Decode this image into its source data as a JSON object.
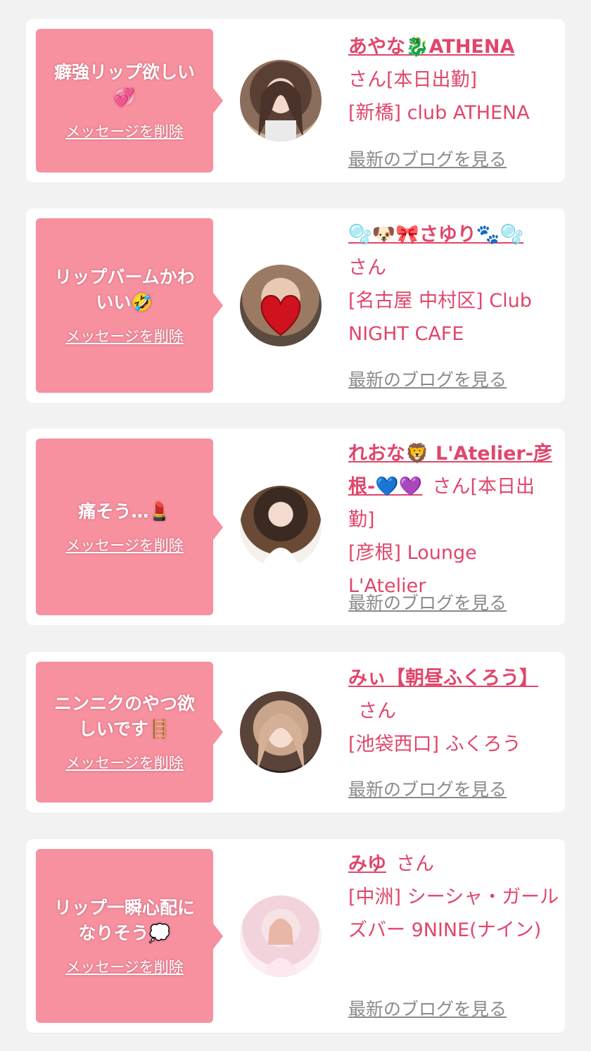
{
  "common": {
    "delete_label": "メッセージを削除",
    "blog_label": "最新のブログを見る",
    "honorific": "さん"
  },
  "colors": {
    "page_bg": "#f2f2f2",
    "card_bg": "#ffffff",
    "bubble_bg": "#f7909f",
    "accent": "#e0466b",
    "link_gray": "#8a8a8a"
  },
  "messages": [
    {
      "text": "癖強リップ欲しい\n💞",
      "name": "あやな🐉ATHENA",
      "status": "[本日出勤]",
      "shop": "[新橋] club ATHENA",
      "avatar_icon": "woman-portrait-photo"
    },
    {
      "text": "リップバームかわ\nいい🤣",
      "name": "🫧🐶🎀さゆり🐾🫧",
      "status": "",
      "shop": "[名古屋 中村区] Club NIGHT CAFE",
      "avatar_icon": "heart-covered-photo"
    },
    {
      "text": "痛そう…💄",
      "name": "れおな🦁 L'Atelier-彦根-💙💜",
      "status": "[本日出勤]",
      "shop": "[彦根] Lounge L'Atelier",
      "avatar_icon": "woman-white-dress-photo"
    },
    {
      "text": "ニンニクのやつ欲\nしいです🪜",
      "name": "みぃ【朝昼ふくろう】",
      "status": "",
      "shop": "[池袋西口] ふくろう",
      "avatar_icon": "woman-selfie-photo"
    },
    {
      "text": "リップ一瞬心配に\nなりそう💭",
      "name": "みゆ",
      "status": "",
      "shop": "[中洲] シーシャ・ガールズバー 9NINE(ナイン)",
      "avatar_icon": "woman-pink-photo"
    }
  ]
}
